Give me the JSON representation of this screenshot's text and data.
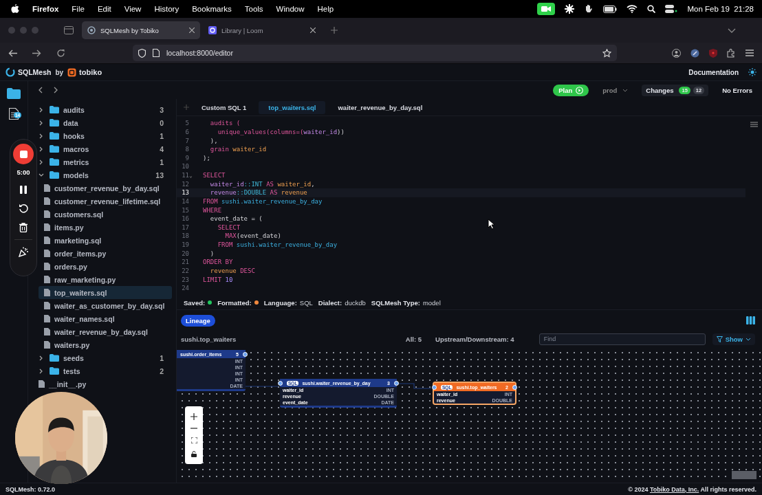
{
  "menubar": {
    "app": "Firefox",
    "menus": [
      "File",
      "Edit",
      "View",
      "History",
      "Bookmarks",
      "Tools",
      "Window",
      "Help"
    ],
    "clock": "Mon Feb 19  21:28"
  },
  "browser": {
    "tabs": [
      {
        "title": "SQLMesh by Tobiko",
        "selected": true
      },
      {
        "title": "Library | Loom",
        "selected": false
      }
    ],
    "url": "localhost:8000/editor"
  },
  "app": {
    "brand": "SQLMesh",
    "by": "by",
    "company": "tobiko",
    "documentation": "Documentation"
  },
  "toolbar": {
    "plan": "Plan",
    "environment": "prod",
    "changes": "Changes",
    "added": "15",
    "removed": "12",
    "errors": "No Errors"
  },
  "activity_bar": {
    "files_badge": "14"
  },
  "recorder": {
    "timer": "5:00"
  },
  "file_tree": [
    {
      "kind": "folder",
      "name": "audits",
      "count": "3",
      "expanded": false
    },
    {
      "kind": "folder",
      "name": "data",
      "count": "0",
      "expanded": false
    },
    {
      "kind": "folder",
      "name": "hooks",
      "count": "1",
      "expanded": false
    },
    {
      "kind": "folder",
      "name": "macros",
      "count": "4",
      "expanded": false
    },
    {
      "kind": "folder",
      "name": "metrics",
      "count": "1",
      "expanded": false
    },
    {
      "kind": "folder",
      "name": "models",
      "count": "13",
      "expanded": true,
      "children": [
        {
          "kind": "file",
          "name": "customer_revenue_by_day.sql",
          "selected": false
        },
        {
          "kind": "file",
          "name": "customer_revenue_lifetime.sql",
          "selected": false
        },
        {
          "kind": "file",
          "name": "customers.sql",
          "selected": false
        },
        {
          "kind": "file",
          "name": "items.py",
          "selected": false
        },
        {
          "kind": "file",
          "name": "marketing.sql",
          "selected": false
        },
        {
          "kind": "file",
          "name": "order_items.py",
          "selected": false
        },
        {
          "kind": "file",
          "name": "orders.py",
          "selected": false
        },
        {
          "kind": "file",
          "name": "raw_marketing.py",
          "selected": false
        },
        {
          "kind": "file",
          "name": "top_waiters.sql",
          "selected": true
        },
        {
          "kind": "file",
          "name": "waiter_as_customer_by_day.sql",
          "selected": false
        },
        {
          "kind": "file",
          "name": "waiter_names.sql",
          "selected": false
        },
        {
          "kind": "file",
          "name": "waiter_revenue_by_day.sql",
          "selected": false
        },
        {
          "kind": "file",
          "name": "waiters.py",
          "selected": false
        }
      ]
    },
    {
      "kind": "folder",
      "name": "seeds",
      "count": "1",
      "expanded": false
    },
    {
      "kind": "folder",
      "name": "tests",
      "count": "2",
      "expanded": false
    },
    {
      "kind": "file",
      "name": "__init__.py",
      "selected": false
    }
  ],
  "editor": {
    "tabs": [
      {
        "title": "Custom SQL 1",
        "selected": false
      },
      {
        "title": "top_waiters.sql",
        "selected": true
      },
      {
        "title": "waiter_revenue_by_day.sql",
        "selected": false
      }
    ],
    "lines": [
      {
        "n": "5",
        "current": false,
        "tokens": [
          {
            "kind": "kw",
            "text": "  audits ("
          }
        ]
      },
      {
        "n": "6",
        "current": false,
        "tokens": [
          {
            "kind": "kw",
            "text": "    unique_values(columns=("
          },
          {
            "kind": "var",
            "text": "waiter_id"
          },
          {
            "kind": "p",
            "text": "))"
          }
        ]
      },
      {
        "n": "7",
        "current": false,
        "tokens": [
          {
            "kind": "p",
            "text": "  ),"
          }
        ]
      },
      {
        "n": "8",
        "current": false,
        "tokens": [
          {
            "kind": "kw",
            "text": "  grain "
          },
          {
            "kind": "id",
            "text": "waiter_id"
          }
        ]
      },
      {
        "n": "9",
        "current": false,
        "tokens": [
          {
            "kind": "p",
            "text": ");"
          }
        ]
      },
      {
        "n": "10",
        "current": false
      },
      {
        "n": "11",
        "current": false,
        "fold": "⌄",
        "tokens": [
          {
            "kind": "kw",
            "text": "SELECT"
          }
        ]
      },
      {
        "n": "12",
        "current": false,
        "tokens": [
          {
            "kind": "var",
            "text": "  waiter_id"
          },
          {
            "kind": "op",
            "text": "::"
          },
          {
            "kind": "type",
            "text": "INT"
          },
          {
            "kind": "kw",
            "text": " AS "
          },
          {
            "kind": "id",
            "text": "waiter_id"
          },
          {
            "kind": "p",
            "text": ","
          }
        ]
      },
      {
        "n": "13",
        "current": true,
        "tokens": [
          {
            "kind": "var",
            "text": "  revenue"
          },
          {
            "kind": "op",
            "text": "::"
          },
          {
            "kind": "type",
            "text": "DOUBLE"
          },
          {
            "kind": "kw",
            "text": " AS "
          },
          {
            "kind": "id",
            "text": "revenue"
          }
        ]
      },
      {
        "n": "14",
        "current": false,
        "tokens": [
          {
            "kind": "kw",
            "text": "FROM "
          },
          {
            "kind": "tbl",
            "text": "sushi.waiter_revenue_by_day"
          }
        ]
      },
      {
        "n": "15",
        "current": false,
        "tokens": [
          {
            "kind": "kw",
            "text": "WHERE"
          }
        ]
      },
      {
        "n": "16",
        "current": false,
        "tokens": [
          {
            "kind": "p",
            "text": "  event_date = ("
          }
        ]
      },
      {
        "n": "17",
        "current": false,
        "tokens": [
          {
            "kind": "kw",
            "text": "    SELECT"
          }
        ]
      },
      {
        "n": "18",
        "current": false,
        "tokens": [
          {
            "kind": "kw",
            "text": "      MAX"
          },
          {
            "kind": "p",
            "text": "(event_date)"
          }
        ]
      },
      {
        "n": "19",
        "current": false,
        "tokens": [
          {
            "kind": "kw",
            "text": "    FROM "
          },
          {
            "kind": "tbl",
            "text": "sushi.waiter_revenue_by_day"
          }
        ]
      },
      {
        "n": "20",
        "current": false,
        "tokens": [
          {
            "kind": "p",
            "text": "  )"
          }
        ]
      },
      {
        "n": "21",
        "current": false,
        "tokens": [
          {
            "kind": "kw",
            "text": "ORDER BY"
          }
        ]
      },
      {
        "n": "22",
        "current": false,
        "tokens": [
          {
            "kind": "id",
            "text": "  revenue"
          },
          {
            "kind": "kw",
            "text": " DESC"
          }
        ]
      },
      {
        "n": "23",
        "current": false,
        "tokens": [
          {
            "kind": "kw",
            "text": "LIMIT "
          },
          {
            "kind": "num",
            "text": "10"
          }
        ]
      },
      {
        "n": "24",
        "current": false
      }
    ]
  },
  "status": [
    {
      "label": "Saved:",
      "color": "#22c55e"
    },
    {
      "label": "Formatted:",
      "color": "#f0883e"
    },
    {
      "label": "Language:",
      "value": "SQL"
    },
    {
      "label": "Dialect:",
      "value": "duckdb"
    },
    {
      "label": "SQLMesh Type:",
      "value": "model"
    }
  ],
  "lineage": {
    "tab": "Lineage",
    "model": "sushi.top_waiters",
    "all": "All: 5",
    "updown": "Upstream/Downstream: 4",
    "find_placeholder": "Find",
    "show": "Show",
    "nodes": [
      {
        "title": "sushi.order_items",
        "count": "5",
        "active": false,
        "columns": [
          {
            "type": "INT"
          },
          {
            "type": "INT"
          },
          {
            "type": "INT"
          },
          {
            "type": "INT"
          },
          {
            "type": "DATE"
          }
        ]
      },
      {
        "title": "sushi.waiter_revenue_by_day",
        "count": "3",
        "badge": "SQL",
        "active": false,
        "columns": [
          {
            "name": "waiter_id",
            "type": "INT"
          },
          {
            "name": "revenue",
            "type": "DOUBLE"
          },
          {
            "name": "event_date",
            "type": "DATE"
          }
        ]
      },
      {
        "title": "sushi.top_waiters",
        "count": "2",
        "badge": "SQL",
        "active": true,
        "columns": [
          {
            "name": "waiter_id",
            "type": "INT"
          },
          {
            "name": "revenue",
            "type": "DOUBLE"
          }
        ]
      }
    ]
  },
  "footer": {
    "version_label": "SQLMesh:",
    "version": "0.72.0",
    "copyright": "© 2024",
    "company_link": "Tobiko Data, Inc.",
    "rights": "All rights reserved."
  }
}
